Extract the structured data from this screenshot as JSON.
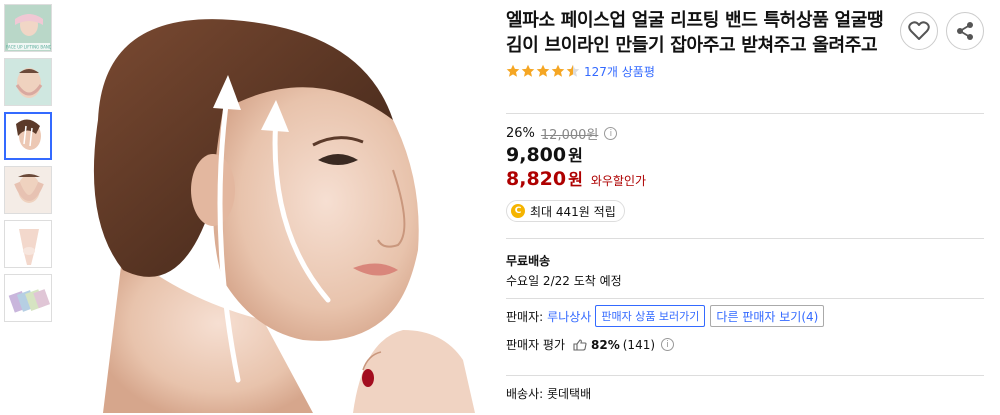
{
  "product": {
    "title": "엘파소 페이스업 얼굴 리프팅 밴드 특허상품 얼굴땡김이 브이라인 만들기 잡아주고 받쳐주고 올려주고",
    "rating": 4.5,
    "review_count": "127개 상품평"
  },
  "thumbnails": [
    {
      "label": "FACE UP LIFTING BAND",
      "color": "#b9d7c8"
    },
    {
      "color": "#cfe7e0"
    },
    {
      "color": "#e8d2c4"
    },
    {
      "color": "#e9dcd0"
    },
    {
      "color": "#f3e2da"
    },
    {
      "color": "#c9b6dc"
    }
  ],
  "pricing": {
    "discount_rate": "26%",
    "original_price": "12,000원",
    "info_icon": "i",
    "price": "9,800",
    "price_unit": "원",
    "wow_price": "8,820",
    "wow_unit": "원",
    "wow_label": "와우할인가"
  },
  "reward": {
    "coin_symbol": "C",
    "text": "최대 441원 적립"
  },
  "shipping": {
    "title": "무료배송",
    "date": "수요일 2/22 도착 예정"
  },
  "seller": {
    "label": "판매자:",
    "name": "루나상사",
    "view_products": "판매자 상품 보러가기",
    "other_sellers": "다른 판매자 보기(4)"
  },
  "seller_rating": {
    "label": "판매자 평가",
    "score": "82%",
    "count": "(141)",
    "info_icon": "i"
  },
  "carrier": {
    "text": "배송사: 롯데택배"
  },
  "colors": {
    "accent": "#346aff",
    "wow_red": "#ae0000",
    "star": "#f5a623"
  }
}
